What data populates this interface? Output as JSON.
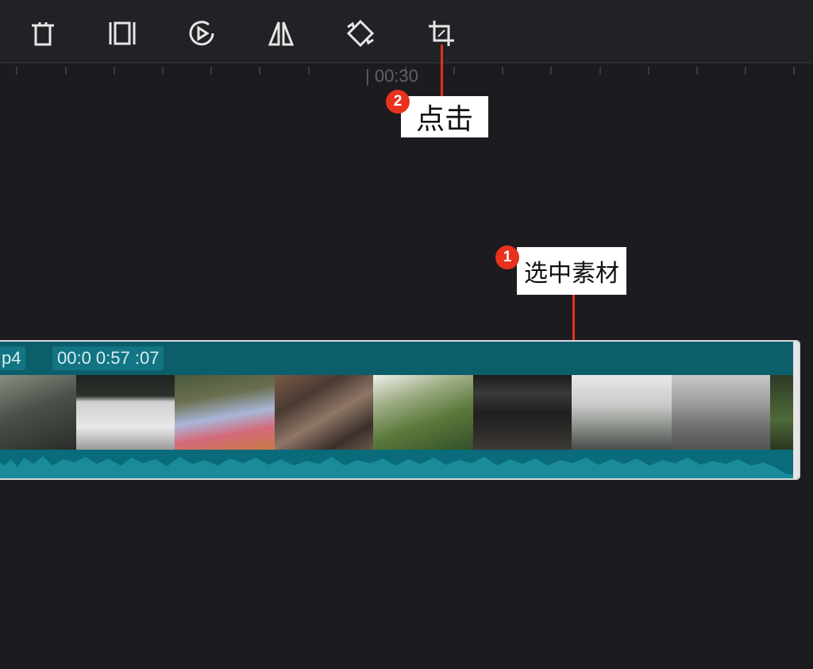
{
  "toolbar": {
    "tools": [
      {
        "name": "delete",
        "icon": "trash-icon"
      },
      {
        "name": "split",
        "icon": "split-icon"
      },
      {
        "name": "speed",
        "icon": "play-circle-icon"
      },
      {
        "name": "mirror",
        "icon": "mirror-icon"
      },
      {
        "name": "rotate",
        "icon": "rotate-icon"
      },
      {
        "name": "crop",
        "icon": "crop-icon"
      }
    ]
  },
  "ruler": {
    "label": "| 00:30"
  },
  "callouts": [
    {
      "number": "2",
      "text": "点击"
    },
    {
      "number": "1",
      "text": "选中素材"
    }
  ],
  "clip": {
    "name_fragment": "p4",
    "duration": "00:0 0:57 :07"
  },
  "colors": {
    "background": "#1c1b1f",
    "toolbar": "#222226",
    "clip": "#0b6775",
    "callout": "#e8321d"
  }
}
